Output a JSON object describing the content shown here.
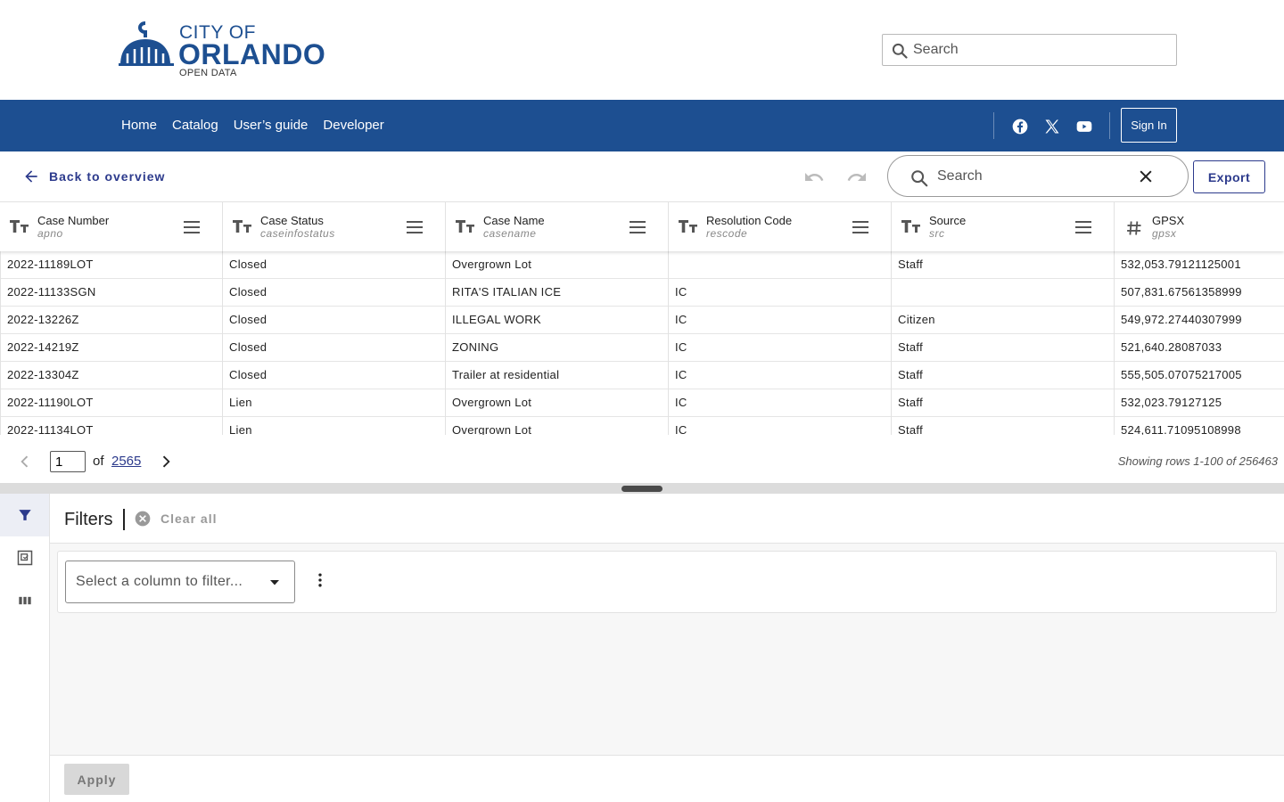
{
  "header": {
    "logo_city": "CITY OF",
    "logo_name": "ORLANDO",
    "logo_sub": "OPEN DATA",
    "search_placeholder": "Search"
  },
  "nav": {
    "links": [
      "Home",
      "Catalog",
      "User’s guide",
      "Developer"
    ],
    "social_icons": [
      "facebook-icon",
      "x-icon",
      "youtube-icon"
    ],
    "signin_label": "Sign In"
  },
  "toolbar": {
    "back_label": "Back to overview",
    "search_placeholder": "Search",
    "export_label": "Export"
  },
  "grid": {
    "columns": [
      {
        "title": "Case Number",
        "field": "apno",
        "type": "text"
      },
      {
        "title": "Case Status",
        "field": "caseinfostatus",
        "type": "text"
      },
      {
        "title": "Case Name",
        "field": "casename",
        "type": "text"
      },
      {
        "title": "Resolution Code",
        "field": "rescode",
        "type": "text"
      },
      {
        "title": "Source",
        "field": "src",
        "type": "text"
      },
      {
        "title": "GPSX",
        "field": "gpsx",
        "type": "number"
      }
    ],
    "rows": [
      [
        "2022-11189LOT",
        "Closed",
        "Overgrown Lot",
        "",
        "Staff",
        "532,053.79121125001"
      ],
      [
        "2022-11133SGN",
        "Closed",
        "RITA'S ITALIAN ICE",
        "IC",
        "",
        "507,831.67561358999"
      ],
      [
        "2022-13226Z",
        "Closed",
        "ILLEGAL WORK",
        "IC",
        "Citizen",
        "549,972.27440307999"
      ],
      [
        "2022-14219Z",
        "Closed",
        "ZONING",
        "IC",
        "Staff",
        "521,640.28087033"
      ],
      [
        "2022-13304Z",
        "Closed",
        "Trailer at residential",
        "IC",
        "Staff",
        "555,505.07075217005"
      ],
      [
        "2022-11190LOT",
        "Lien",
        "Overgrown Lot",
        "IC",
        "Staff",
        "532,023.79127125"
      ],
      [
        "2022-11134LOT",
        "Lien",
        "Overgrown Lot",
        "IC",
        "Staff",
        "524,611.71095108998"
      ]
    ]
  },
  "pager": {
    "current_page": "1",
    "of_label": "of",
    "total_pages": "2565",
    "rows_info": "Showing rows 1-100 of 256463"
  },
  "filters": {
    "title": "Filters",
    "clear_all": "Clear all",
    "select_placeholder": "Select a column to filter...",
    "apply_label": "Apply"
  },
  "colors": {
    "brand": "#1d4f91",
    "accent": "#2c3a8c"
  }
}
